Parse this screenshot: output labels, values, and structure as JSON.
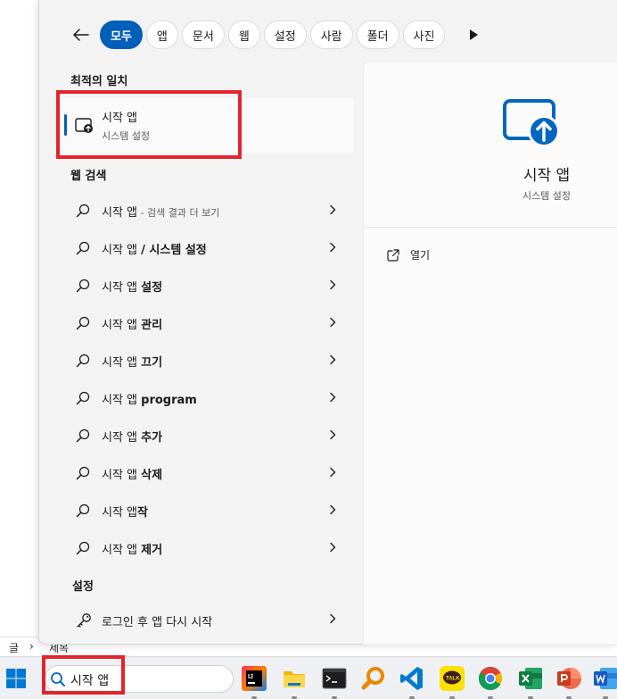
{
  "background": {
    "strip_text_1": "글",
    "strip_text_2": "›",
    "strip_text_3": "제목"
  },
  "filters": {
    "items": [
      "모두",
      "앱",
      "문서",
      "웹",
      "설정",
      "사람",
      "폴더",
      "사진"
    ],
    "active_index": 0
  },
  "best_match": {
    "header": "최적의 일치",
    "title": "시작 앱",
    "subtitle": "시스템 설정",
    "icon": "startup-apps-icon"
  },
  "web_search": {
    "header": "웹 검색",
    "items": [
      {
        "prefix": "시작 앱",
        "bold": "",
        "muted": " - 검색 결과 더 보기"
      },
      {
        "prefix": "시작 앱 ",
        "bold": "/ 시스템 설정",
        "muted": ""
      },
      {
        "prefix": "시작 앱 ",
        "bold": "설정",
        "muted": ""
      },
      {
        "prefix": "시작 앱 ",
        "bold": "관리",
        "muted": ""
      },
      {
        "prefix": "시작 앱 ",
        "bold": "끄기",
        "muted": ""
      },
      {
        "prefix": "시작 앱 ",
        "bold": "program",
        "muted": ""
      },
      {
        "prefix": "시작 앱 ",
        "bold": "추가",
        "muted": ""
      },
      {
        "prefix": "시작 앱 ",
        "bold": "삭제",
        "muted": ""
      },
      {
        "prefix": "시작 앱",
        "bold": "작",
        "muted": ""
      },
      {
        "prefix": "시작 앱 ",
        "bold": "제거",
        "muted": ""
      }
    ]
  },
  "settings": {
    "header": "설정",
    "items": [
      {
        "label": "로그인 후 앱 다시 시작"
      }
    ]
  },
  "preview": {
    "title": "시작 앱",
    "subtitle": "시스템 설정",
    "open_label": "열기"
  },
  "taskbar": {
    "search_value": "시작 앱",
    "apps": [
      "intellij-icon",
      "file-explorer-icon",
      "terminal-icon",
      "search-tool-icon",
      "vscode-icon",
      "kakaotalk-icon",
      "chrome-icon",
      "excel-icon",
      "powerpoint-icon",
      "word-icon"
    ],
    "kakaotalk_label": "TALK"
  },
  "colors": {
    "accent": "#005fb8",
    "highlight": "#e3242b"
  }
}
